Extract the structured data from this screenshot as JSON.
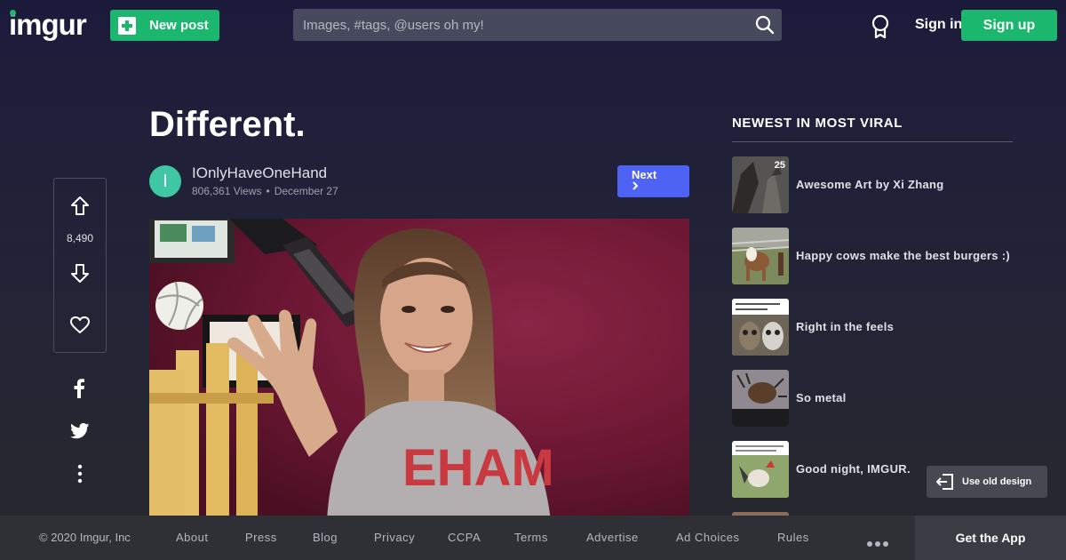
{
  "header": {
    "logo_text": "imgur",
    "new_post_label": "New post",
    "search_placeholder": "Images, #tags, @users oh my!",
    "sign_in_label": "Sign in",
    "sign_up_label": "Sign up",
    "accent_color": "#1bb76e"
  },
  "post": {
    "title": "Different.",
    "author_initial": "I",
    "author": "IOnlyHaveOneHand",
    "views": "806,361 Views",
    "date": "December 27",
    "next_label": "Next",
    "next_color": "#4e62f3"
  },
  "actions": {
    "vote_count": "8,490",
    "icons": [
      "upvote-icon",
      "downvote-icon",
      "heart-icon",
      "facebook-icon",
      "twitter-icon",
      "more-vertical-icon"
    ]
  },
  "sidebar": {
    "title": "NEWEST IN MOST VIRAL",
    "items": [
      {
        "label": "Awesome Art by Xi Zhang",
        "count": "25"
      },
      {
        "label": "Happy cows make the best burgers :)"
      },
      {
        "label": "Right in the feels"
      },
      {
        "label": "So metal"
      },
      {
        "label": "Good night, IMGUR."
      }
    ]
  },
  "old_design_label": "Use old design",
  "footer": {
    "copyright": "© 2020 Imgur, Inc",
    "links": [
      "About",
      "Press",
      "Blog",
      "Privacy",
      "CCPA",
      "Terms",
      "Advertise",
      "Ad Choices",
      "Rules"
    ],
    "get_app_label": "Get the App"
  }
}
